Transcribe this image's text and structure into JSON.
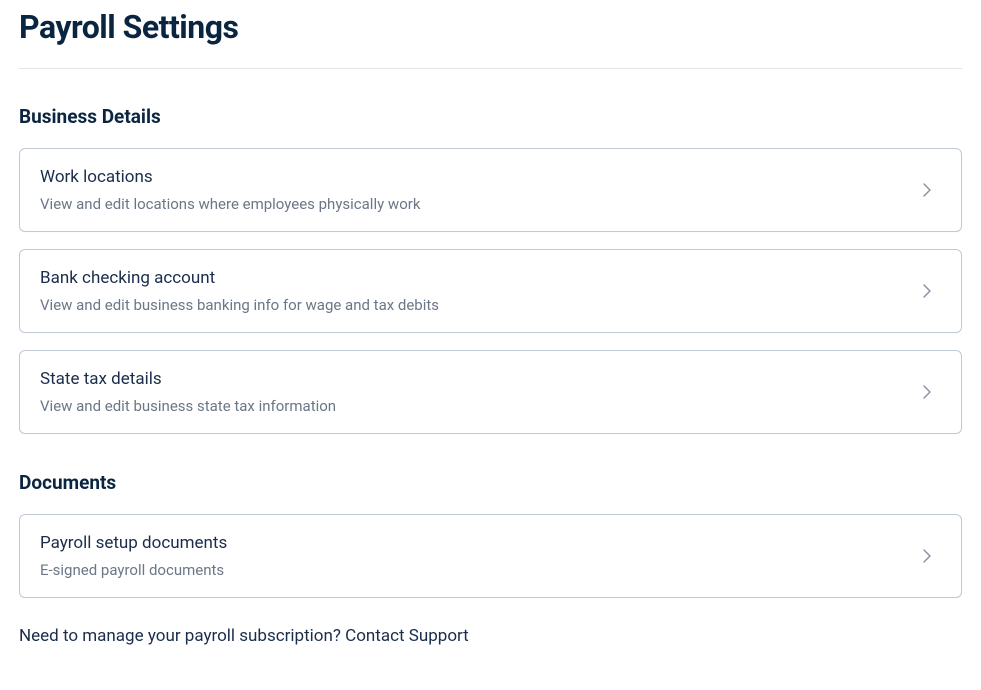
{
  "page": {
    "title": "Payroll Settings"
  },
  "sections": {
    "business": {
      "heading": "Business Details",
      "items": [
        {
          "title": "Work locations",
          "subtitle": "View and edit locations where employees physically work"
        },
        {
          "title": "Bank checking account",
          "subtitle": "View and edit business banking info for wage and tax debits"
        },
        {
          "title": "State tax details",
          "subtitle": "View and edit business state tax information"
        }
      ]
    },
    "documents": {
      "heading": "Documents",
      "items": [
        {
          "title": "Payroll setup documents",
          "subtitle": "E-signed payroll documents"
        }
      ]
    }
  },
  "footer": {
    "prefix": "Need to manage your payroll subscription? ",
    "link": "Contact Support"
  }
}
